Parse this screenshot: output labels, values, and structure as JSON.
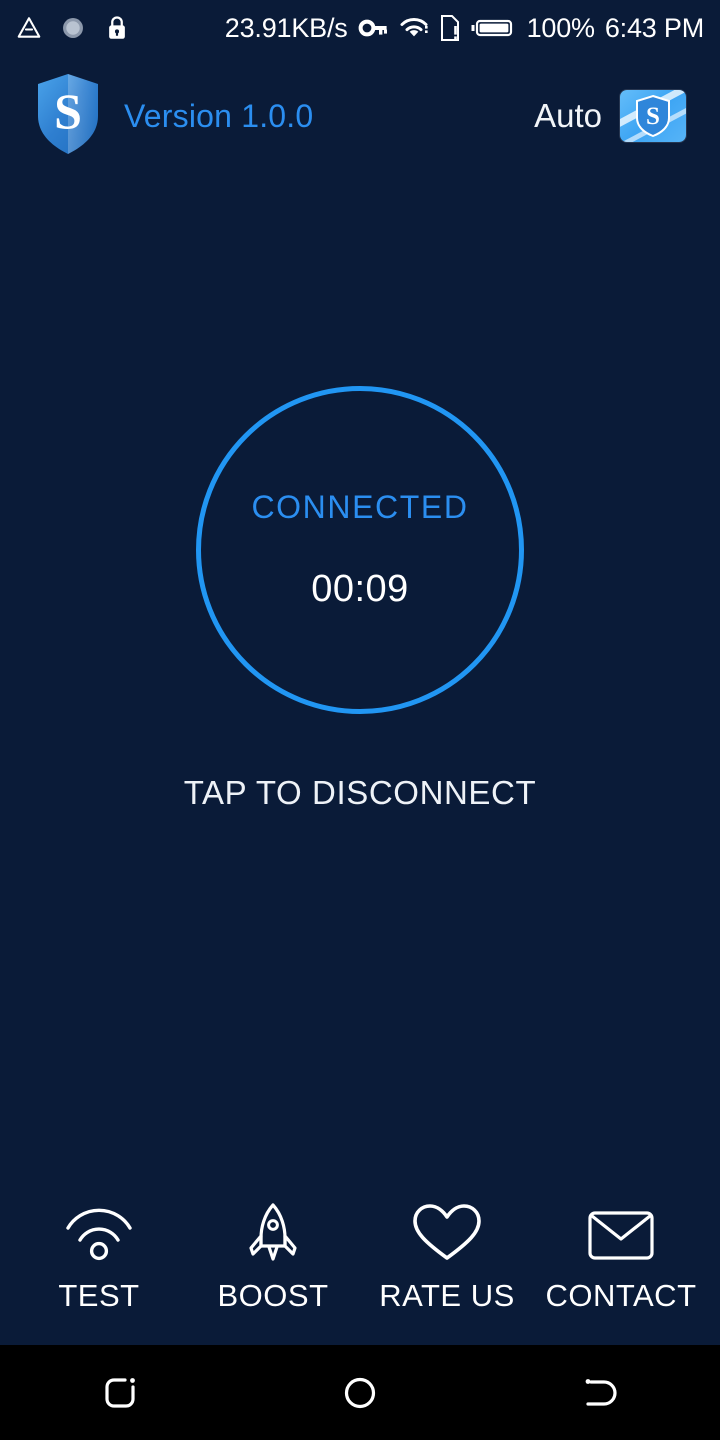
{
  "statusbar": {
    "left_icons": [
      {
        "name": "triangle-alert-icon",
        "label": ""
      },
      {
        "name": "circle-sync-icon",
        "label": ""
      },
      {
        "name": "lock-icon",
        "label": ""
      }
    ],
    "network_speed": "23.91KB/s",
    "right_icons": [
      {
        "name": "vpn-key-icon",
        "label": ""
      },
      {
        "name": "wifi-icon",
        "label": ""
      },
      {
        "name": "sim-alert-icon",
        "label": ""
      },
      {
        "name": "battery-full-icon",
        "label": ""
      }
    ],
    "battery_percent": "100%",
    "clock": "6:43 PM"
  },
  "appbar": {
    "logo_letter": "S",
    "version": "Version 1.0.0",
    "server_label": "Auto",
    "server_flag_letter": "S"
  },
  "connection": {
    "status": "CONNECTED",
    "timer": "00:09",
    "tap_hint": "TAP TO DISCONNECT"
  },
  "actions": [
    {
      "label": "TEST",
      "icon": "signal-test-icon"
    },
    {
      "label": "BOOST",
      "icon": "rocket-icon"
    },
    {
      "label": "RATE US",
      "icon": "heart-icon"
    },
    {
      "label": "CONTACT",
      "icon": "envelope-icon"
    }
  ],
  "navbar": [
    {
      "name": "recent-apps-button"
    },
    {
      "name": "home-button"
    },
    {
      "name": "back-button"
    }
  ],
  "colors": {
    "background": "#0a1b38",
    "accent_blue": "#2196f3",
    "version_blue": "#2b8ef0",
    "text_white": "#ffffff",
    "navbar_black": "#000000"
  }
}
